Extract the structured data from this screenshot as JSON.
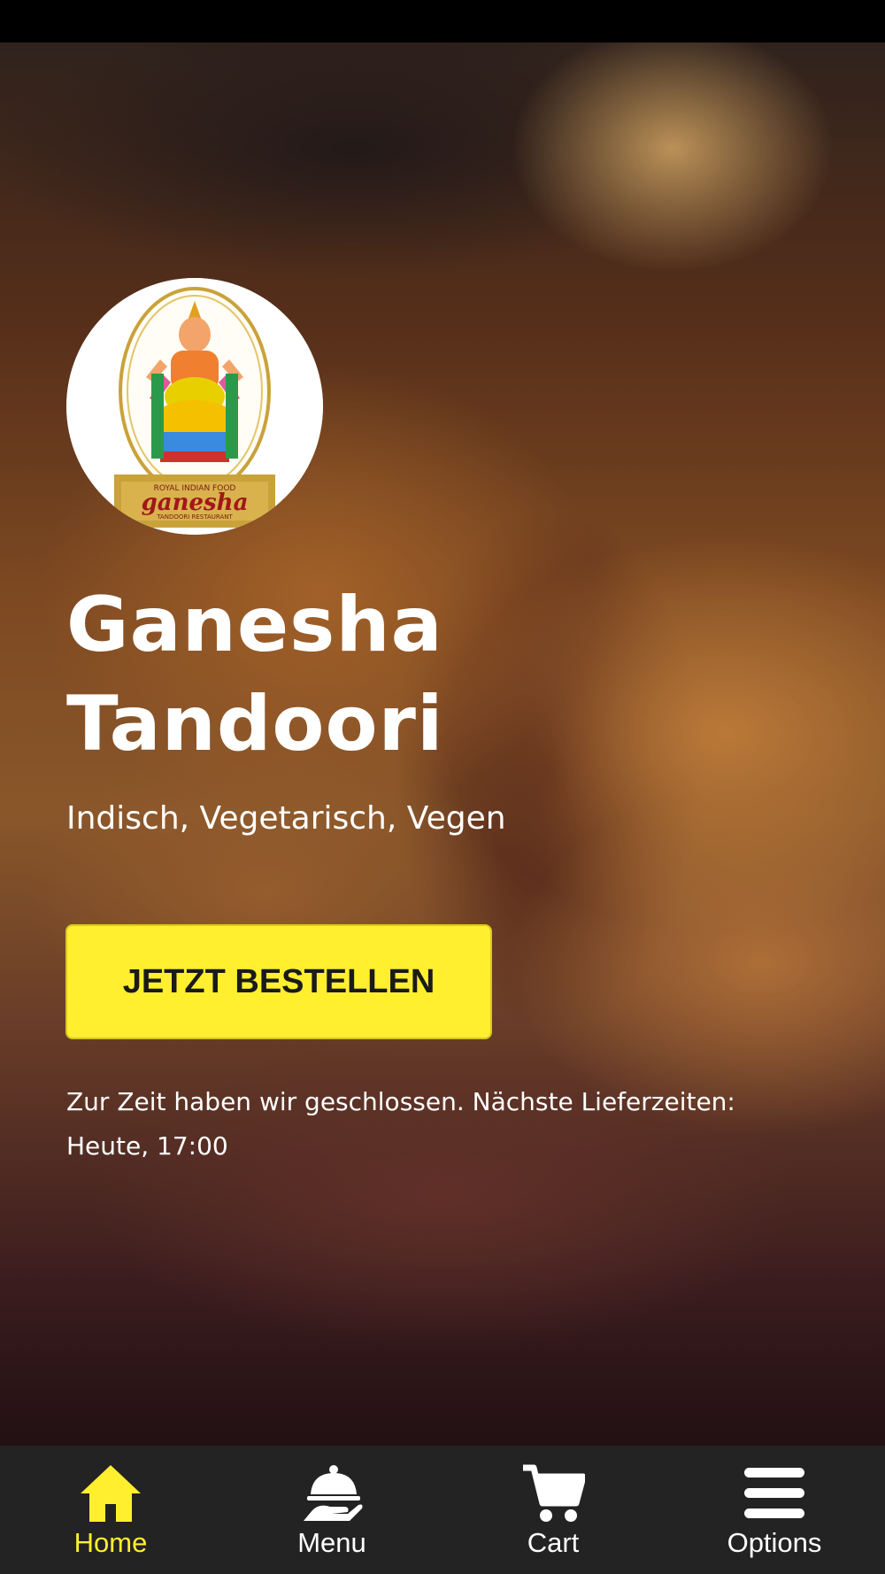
{
  "restaurant": {
    "name_line1": "Ganesha",
    "name_line2": "Tandoori",
    "cuisines": "Indisch, Vegetarisch, Vegen",
    "logo": {
      "top_text": "ROYAL INDIAN FOOD",
      "brand_text": "ganesha",
      "bottom_text": "TANDOORI RESTAURANT"
    }
  },
  "actions": {
    "order_label": "JETZT BESTELLEN"
  },
  "status": {
    "line1": "Zur Zeit haben wir geschlossen. Nächste Lieferzeiten:",
    "line2": "Heute, 17:00"
  },
  "nav": {
    "items": [
      {
        "label": "Home",
        "icon": "home-icon",
        "active": true
      },
      {
        "label": "Menu",
        "icon": "serving-cloche-icon",
        "active": false
      },
      {
        "label": "Cart",
        "icon": "cart-icon",
        "active": false
      },
      {
        "label": "Options",
        "icon": "menu-bars-icon",
        "active": false
      }
    ]
  },
  "colors": {
    "accent": "#ffef2e",
    "nav_background": "#232323",
    "text": "#ffffff"
  }
}
